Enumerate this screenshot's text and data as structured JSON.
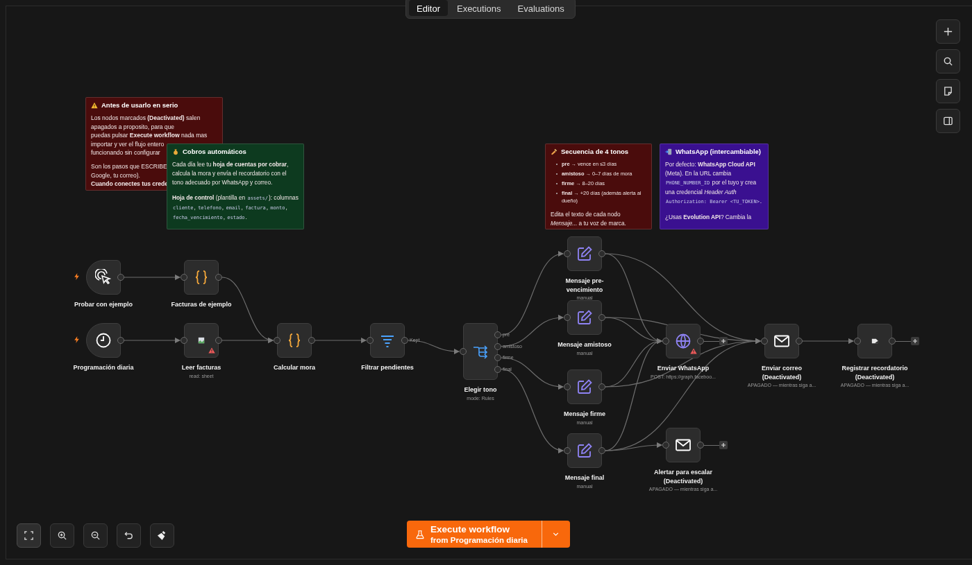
{
  "tabs": [
    {
      "label": "Editor",
      "selected": true
    },
    {
      "label": "Executions",
      "selected": false
    },
    {
      "label": "Evaluations",
      "selected": false
    }
  ],
  "notes": [
    {
      "color": "#4a0c0c",
      "title": "Antes de usarlo en serio",
      "blocks": [
        {
          "kind": "lines",
          "lines": [
            "Los nodos marcados **(Deactivated)** salen",
            "apagados a proposito, para que",
            "puedas pulsar **Execute workflow** nada mas",
            "importar y ver el flujo entero",
            "funcionando sin configurar"
          ]
        },
        {
          "kind": "lines",
          "lines": [
            "Son los pasos que ESCRIBE",
            "Google, tu correo).",
            "**Cuando conectes tus crede**"
          ]
        }
      ]
    },
    {
      "color": "#0d3a1f",
      "title": "Cobros automáticos",
      "blocks": [
        {
          "kind": "para",
          "segments": [
            {
              "kind": "text",
              "text": "Cada día lee tu **hoja de cuentas por cobrar**, calcula la mora y envía el recordatorio con el tono adecuado por WhatsApp y correo."
            }
          ]
        },
        {
          "kind": "para",
          "segments": [
            {
              "kind": "text",
              "text": "**Hoja de control** (plantilla en "
            },
            {
              "kind": "code",
              "text": "assets/"
            },
            {
              "kind": "text",
              "text": "): columnas "
            },
            {
              "kind": "code",
              "text": "cliente"
            },
            {
              "kind": "text",
              "text": ", "
            },
            {
              "kind": "code",
              "text": "telefono"
            },
            {
              "kind": "text",
              "text": ", "
            },
            {
              "kind": "code",
              "text": "email"
            },
            {
              "kind": "text",
              "text": ", "
            },
            {
              "kind": "code",
              "text": "factura"
            },
            {
              "kind": "text",
              "text": ", "
            },
            {
              "kind": "code",
              "text": "monto"
            },
            {
              "kind": "text",
              "text": ", "
            },
            {
              "kind": "code",
              "text": "fecha_vencimiento"
            },
            {
              "kind": "text",
              "text": ", "
            },
            {
              "kind": "code",
              "text": "estado"
            },
            {
              "kind": "text",
              "text": "."
            }
          ]
        }
      ]
    },
    {
      "color": "#4a0c0c",
      "title": "Secuencia de 4 tonos",
      "blocks": [
        {
          "kind": "list",
          "items": [
            "**pre** → vence en ≤3 días",
            "**amistoso** → 0–7 días de mora",
            "**firme** → 8–20 días",
            "**final** → +20 días (además alerta al dueño)"
          ]
        },
        {
          "kind": "para",
          "segments": [
            {
              "kind": "text",
              "text": "Edita el texto de cada nodo *Mensaje...* a tu voz de marca."
            }
          ]
        }
      ]
    },
    {
      "color": "#3a1090",
      "title": "WhatsApp (intercambiable)",
      "blocks": [
        {
          "kind": "para",
          "segments": [
            {
              "kind": "text",
              "text": "Por defecto: **WhatsApp Cloud API** (Meta). En la URL cambia "
            },
            {
              "kind": "code",
              "text": "PHONE_NUMBER_ID"
            },
            {
              "kind": "text",
              "text": " por el tuyo y crea una credencial *Header Auth* "
            },
            {
              "kind": "code",
              "text": "Authorization: Bearer <TU_TOKEN>"
            },
            {
              "kind": "text",
              "text": "."
            }
          ]
        },
        {
          "kind": "para",
          "segments": [
            {
              "kind": "text",
              "text": "¿Usas **Evolution API**? Cambia la"
            }
          ]
        }
      ]
    }
  ],
  "nodes": [
    {
      "kind": "trigger",
      "title": "Probar con ejemplo",
      "warning": false
    },
    {
      "kind": "action",
      "title": "Facturas de ejemplo",
      "warning": false
    },
    {
      "kind": "trigger",
      "title": "Programación diaria",
      "warning": false
    },
    {
      "kind": "action",
      "title": "Leer facturas",
      "subtitle": "read: sheet",
      "warning": true
    },
    {
      "kind": "action",
      "title": "Calcular mora",
      "warning": false
    },
    {
      "kind": "action",
      "title": "Filtrar pendientes",
      "outputs": [
        "Kept"
      ],
      "warning": false
    },
    {
      "kind": "switch",
      "title": "Elegir tono",
      "subtitle": "mode: Rules",
      "outputs": [
        "pre",
        "amistoso",
        "firme",
        "final"
      ],
      "warning": false
    },
    {
      "kind": "action",
      "title": "Mensaje pre-vencimiento",
      "subtitle": "manual",
      "warning": false
    },
    {
      "kind": "action",
      "title": "Mensaje amistoso",
      "subtitle": "manual",
      "warning": false
    },
    {
      "kind": "action",
      "title": "Enviar WhatsApp",
      "subtitle": "POST: https://graph.faceboo...",
      "warning": true
    },
    {
      "kind": "action",
      "title": "Enviar correo (Deactivated)",
      "subtitle": "APAGADO — mientras siga a...",
      "warning": false
    },
    {
      "kind": "action",
      "title": "Registrar recordatorio (Deactivated)",
      "subtitle": "APAGADO — mientras siga a...",
      "warning": false
    },
    {
      "kind": "action",
      "title": "Mensaje firme",
      "subtitle": "manual",
      "warning": false
    },
    {
      "kind": "action",
      "title": "Mensaje final",
      "subtitle": "manual",
      "warning": false
    },
    {
      "kind": "action",
      "title": "Alertar para escalar (Deactivated)",
      "subtitle": "APAGADO — mientras siga a...",
      "warning": false
    }
  ],
  "execute": {
    "label": "Execute workflow",
    "sublabel": "from Programación diaria"
  }
}
